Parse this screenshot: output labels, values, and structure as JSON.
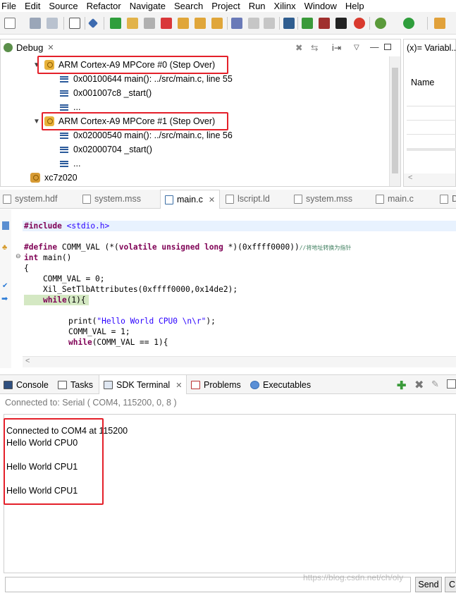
{
  "menubar": [
    "File",
    "Edit",
    "Source",
    "Refactor",
    "Navigate",
    "Search",
    "Project",
    "Run",
    "Xilinx",
    "Window",
    "Help"
  ],
  "debug_view": {
    "title": "Debug",
    "threads": [
      {
        "label": "ARM Cortex-A9 MPCore #0 (Step Over)",
        "frames": [
          "0x00100644 main(): ../src/main.c, line 55",
          "0x001007c8 _start()",
          "..."
        ]
      },
      {
        "label": "ARM Cortex-A9 MPCore #1 (Step Over)",
        "frames": [
          "0x02000540 main(): ../src/main.c, line 56",
          "0x02000704 _start()",
          "..."
        ]
      }
    ],
    "target": "xc7z020"
  },
  "variables_view": {
    "title": "(x)= Variabl...",
    "column": "Name"
  },
  "editor": {
    "tabs": [
      "system.hdf",
      "system.mss",
      "main.c",
      "lscript.ld",
      "system.mss",
      "main.c",
      "D"
    ],
    "active_tab": 2,
    "lines": {
      "include_kw": "#include",
      "include_file": "<stdio.h>",
      "define_kw": "#define",
      "define_name": " COMM_VAL (*(",
      "define_types": "volatile unsigned long",
      "define_rest": " *)(0xffff0000))",
      "define_comment": "//将地址转换为指针",
      "int_kw": "int",
      "main_decl": " main()",
      "brace_open": "{",
      "assign": "    COMM_VAL = 0;",
      "xil": "    Xil_SetTlbAttributes(0xffff0000,0x14de2);",
      "while_kw": "while",
      "while_rest": "(1){",
      "print_fn": "print(",
      "print_str": "\"Hello World CPU0 \\n\\r\"",
      "print_end": ");",
      "assign1": "COMM_VAL = 1;",
      "while2_kw": "while",
      "while2_rest": "(COMM_VAL == 1){"
    }
  },
  "bottom_panel": {
    "tabs": [
      "Console",
      "Tasks",
      "SDK Terminal",
      "Problems",
      "Executables"
    ],
    "active_tab": 2,
    "connection": "Connected to: Serial (  COM4, 115200, 0, 8 )",
    "terminal_lines": [
      "Connected to COM4 at 115200",
      "Hello World CPU0",
      "",
      "Hello World CPU1",
      "",
      "Hello World CPU1"
    ],
    "send_label": "Send",
    "clear_label": "C",
    "watermark": "https://blog.csdn.net/ch/oly"
  },
  "colors": {
    "highlight_red": "#e4202a",
    "keyword": "#7f0055",
    "string": "#2a00ff",
    "comment": "#3f7f5f",
    "active_line": "#d4e8c3"
  }
}
